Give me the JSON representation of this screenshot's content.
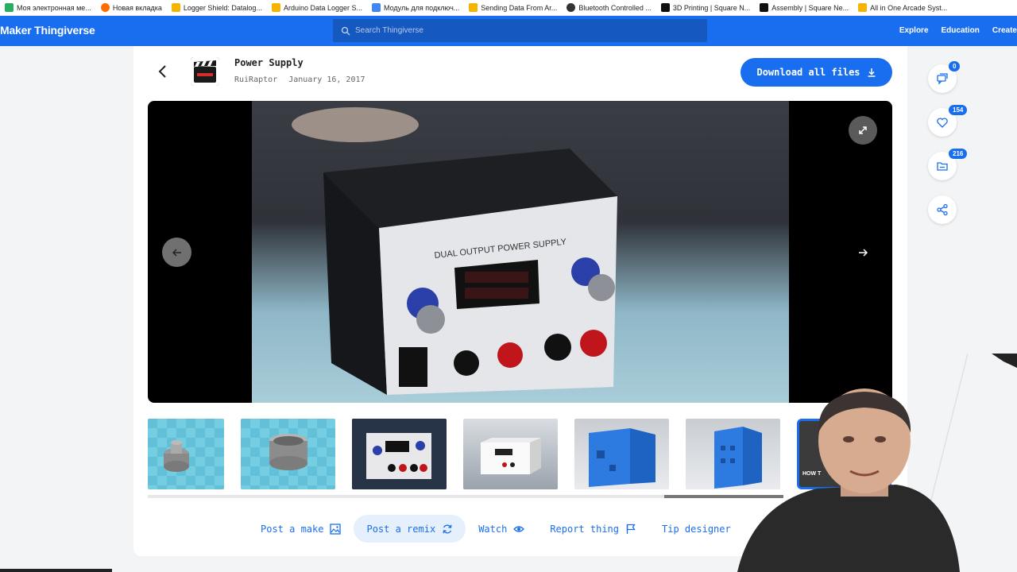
{
  "bookmarks": [
    {
      "label": "Моя электронная ме...",
      "color": "#27ae60"
    },
    {
      "label": "Новая вкладка",
      "color": "#ff6d00"
    },
    {
      "label": "Logger Shield: Datalog...",
      "color": "#f4b400"
    },
    {
      "label": "Arduino Data Logger S...",
      "color": "#f4b400"
    },
    {
      "label": "Модуль для подключ...",
      "color": "#4285f4"
    },
    {
      "label": "Sending Data From Ar...",
      "color": "#f4b400"
    },
    {
      "label": "Bluetooth Controlled ...",
      "color": "#333333"
    },
    {
      "label": "3D Printing | Square N...",
      "color": "#111111"
    },
    {
      "label": "Assembly | Square Ne...",
      "color": "#111111"
    },
    {
      "label": "All in One Arcade Syst...",
      "color": "#f4b400"
    }
  ],
  "nav": {
    "logo": "Maker Thingiverse",
    "search_placeholder": "Search Thingiverse",
    "links": [
      "Explore",
      "Education",
      "Create"
    ]
  },
  "thing": {
    "title": "Power Supply",
    "author": "RuiRaptor",
    "date": "January 16, 2017",
    "download_label": "Download all files"
  },
  "rail": {
    "comments": "0",
    "likes": "154",
    "remixes": "216"
  },
  "actions": [
    {
      "label": "Post a make"
    },
    {
      "label": "Post a remix"
    },
    {
      "label": "Watch"
    },
    {
      "label": "Report thing"
    },
    {
      "label": "Tip designer"
    }
  ],
  "photo_panel_text": "DUAL OUTPUT POWER SUPPLY",
  "thumb_text": "HOW T",
  "colors": {
    "brand": "#196ef0",
    "background": "#f3f4f6"
  }
}
